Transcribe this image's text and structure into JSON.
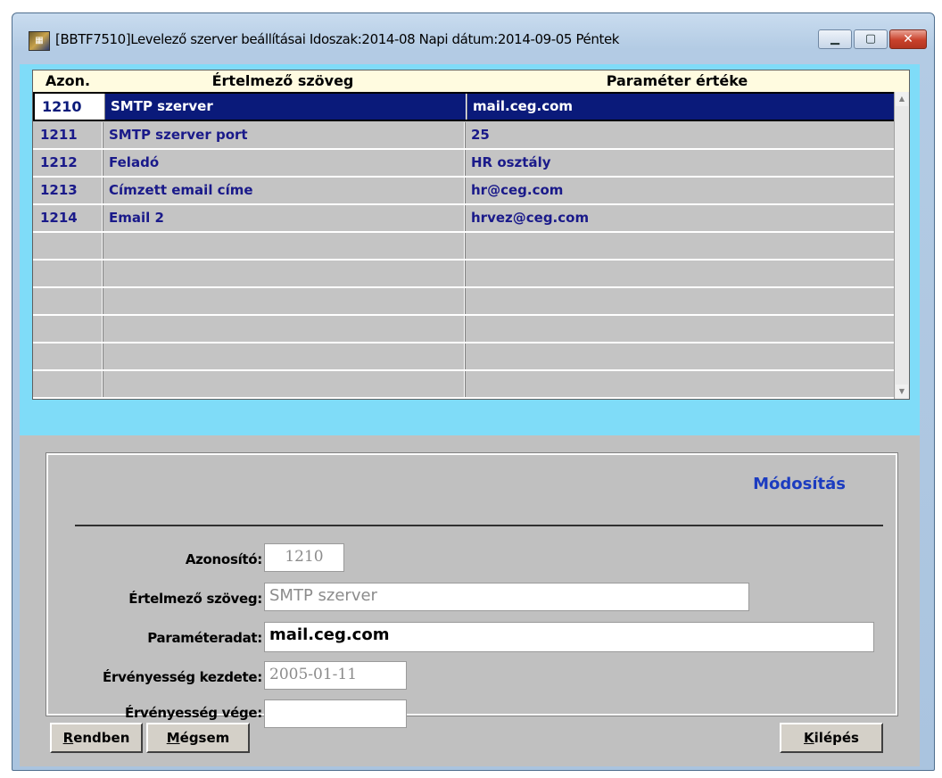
{
  "window": {
    "title": "[BBTF7510]Levelező szerver beállításai Idoszak:2014-08 Napi dátum:2014-09-05 Péntek",
    "icon": "app-icon",
    "controls": [
      "minimize-icon",
      "maximize-icon",
      "close-icon"
    ]
  },
  "grid": {
    "headers": {
      "id": "Azon.",
      "desc": "Értelmező szöveg",
      "value": "Paraméter értéke"
    },
    "rows": [
      {
        "id": "1210",
        "desc": "SMTP szerver",
        "value": "mail.ceg.com"
      },
      {
        "id": "1211",
        "desc": "SMTP szerver port",
        "value": "25"
      },
      {
        "id": "1212",
        "desc": "Feladó",
        "value": "HR osztály"
      },
      {
        "id": "1213",
        "desc": "Címzett email címe",
        "value": "hr@ceg.com"
      },
      {
        "id": "1214",
        "desc": "Email 2",
        "value": "hrvez@ceg.com"
      }
    ],
    "selected_row": "1210"
  },
  "form": {
    "mode_title": "Módosítás",
    "labels": {
      "id": "Azonosító:",
      "desc": "Értelmező szöveg:",
      "param": "Paraméteradat:",
      "valid_from": "Érvényesség kezdete:",
      "valid_to": "Érvényesség vége:"
    },
    "values": {
      "id": "1210",
      "desc": "SMTP szerver",
      "param": "mail.ceg.com",
      "valid_from": "2005-01-11",
      "valid_to": ""
    }
  },
  "buttons": {
    "ok": {
      "first": "R",
      "rest": "endben"
    },
    "cancel": {
      "first": "M",
      "rest": "égsem"
    },
    "exit": {
      "first": "K",
      "rest": "ilépés"
    }
  },
  "colors": {
    "selection": "#0a1a7a",
    "grid_text": "#1a1a8a",
    "band": "#7fdcf8",
    "mode_title": "#1c3cc0"
  }
}
